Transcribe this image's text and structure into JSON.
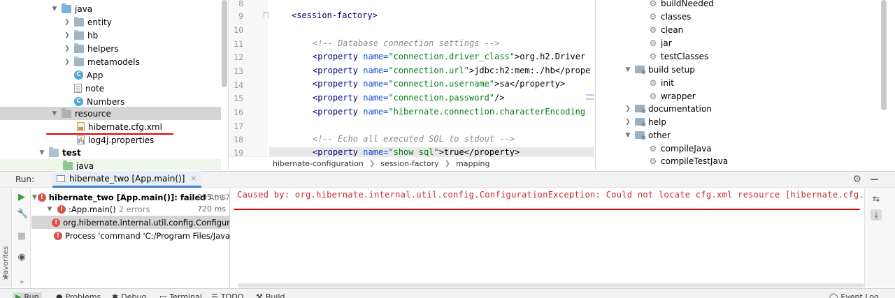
{
  "project_tree": {
    "items": [
      {
        "label": "java",
        "indent": 0,
        "expanded": true,
        "icon": "source-folder-icon"
      },
      {
        "label": "entity",
        "indent": 1,
        "expanded": false,
        "icon": "package-icon"
      },
      {
        "label": "hb",
        "indent": 1,
        "expanded": false,
        "icon": "package-icon"
      },
      {
        "label": "helpers",
        "indent": 1,
        "expanded": false,
        "icon": "package-icon"
      },
      {
        "label": "metamodels",
        "indent": 1,
        "expanded": false,
        "icon": "package-icon"
      },
      {
        "label": "App",
        "indent": 1,
        "icon": "class-icon"
      },
      {
        "label": "note",
        "indent": 1,
        "icon": "file-icon"
      },
      {
        "label": "Numbers",
        "indent": 1,
        "icon": "class-icon"
      },
      {
        "label": "resource",
        "indent": 0,
        "expanded": true,
        "icon": "resource-folder-icon"
      },
      {
        "label": "hibernate.cfg.xml",
        "indent": 1,
        "icon": "xml-file-icon"
      },
      {
        "label": "log4j.properties",
        "indent": 1,
        "icon": "properties-file-icon"
      },
      {
        "label": "test",
        "indent": -1,
        "expanded": true,
        "icon": "folder-icon"
      },
      {
        "label": "java",
        "indent": 0,
        "icon": "test-folder-icon"
      }
    ]
  },
  "editor": {
    "line_numbers": [
      "8",
      "9",
      "10",
      "11",
      "12",
      "13",
      "14",
      "15",
      "16",
      "17",
      "18",
      "19"
    ],
    "lines": {
      "l9_open": "<",
      "l9_tag": "session-factory",
      "l9_close": ">",
      "l11": "<!-- Database connection settings -->",
      "l12": {
        "tag": "<property ",
        "attr": "name=",
        "val": "\"connection.driver_class\"",
        "text": ">org.h2.Driver"
      },
      "l13": {
        "tag": "<property ",
        "attr": "name=",
        "val": "\"connection.url\"",
        "text": ">jdbc:h2:mem:./hb</prope"
      },
      "l14": {
        "tag": "<property ",
        "attr": "name=",
        "val": "\"connection.username\"",
        "text": ">sa</property>"
      },
      "l15": {
        "tag": "<property ",
        "attr": "name=",
        "val": "\"connection.password\"",
        "text": "/>"
      },
      "l16": {
        "tag": "<property ",
        "attr": "name=",
        "val": "\"hibernate.connection.characterEncoding"
      },
      "l18": "<!-- Echo all executed SQL to stdout -->",
      "l19": {
        "tag": "<property ",
        "attr": "name=",
        "val": "\"show_sql\"",
        "text": ">true</property>"
      }
    },
    "breadcrumbs": [
      "hibernate-configuration",
      "session-factory",
      "mapping"
    ]
  },
  "gradle": {
    "items": [
      {
        "label": "buildNeeded",
        "type": "task"
      },
      {
        "label": "classes",
        "type": "task"
      },
      {
        "label": "clean",
        "type": "task"
      },
      {
        "label": "jar",
        "type": "task"
      },
      {
        "label": "testClasses",
        "type": "task"
      },
      {
        "label": "build setup",
        "type": "group",
        "expanded": true
      },
      {
        "label": "init",
        "type": "task"
      },
      {
        "label": "wrapper",
        "type": "task"
      },
      {
        "label": "documentation",
        "type": "group",
        "expanded": false
      },
      {
        "label": "help",
        "type": "group",
        "expanded": false
      },
      {
        "label": "other",
        "type": "group",
        "expanded": true
      },
      {
        "label": "compileJava",
        "type": "task"
      },
      {
        "label": "compileTestJava",
        "type": "task"
      }
    ]
  },
  "run_panel": {
    "label": "Run:",
    "tab_label": "hibernate_two [App.main()]",
    "tab_close": "×",
    "favorites_label": "Favorites",
    "tree": {
      "root_label": "hibernate_two [App.main()]: failed",
      "root_meta": "At 17",
      "root_duration": "995 ms",
      "child_label": ":App.main()",
      "child_meta": "2 errors",
      "child_duration": "720 ms",
      "error1": "org.hibernate.internal.util.config.Configur",
      "error2": "Process 'command 'C:/Program Files/Java"
    },
    "console_text": "Caused by: org.hibernate.internal.util.config.ConfigurationException: Could not locate cfg.xml resource [hibernate.cfg."
  },
  "bottom_bar": {
    "tabs": [
      "Run",
      "Problems",
      "Debug",
      "Terminal",
      "TODO",
      "Build"
    ],
    "right": "Event Log"
  },
  "colors": {
    "error": "#c92a2a",
    "annotation": "#e00000",
    "selection": "#d5d5d5",
    "accent": "#4083c9"
  }
}
